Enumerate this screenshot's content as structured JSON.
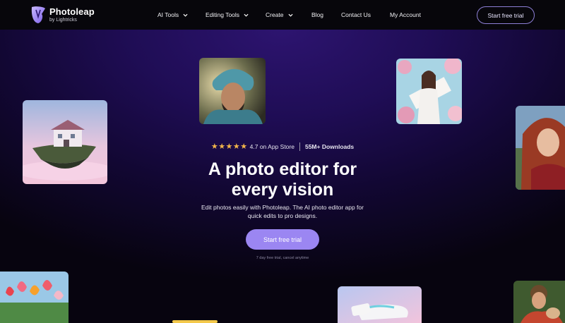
{
  "brand": {
    "name": "Photoleap",
    "sub": "by Lightricks"
  },
  "nav": {
    "items": [
      {
        "label": "AI Tools",
        "dropdown": true
      },
      {
        "label": "Editing Tools",
        "dropdown": true
      },
      {
        "label": "Create",
        "dropdown": true
      },
      {
        "label": "Blog",
        "dropdown": false
      },
      {
        "label": "Contact Us",
        "dropdown": false
      },
      {
        "label": "My Account",
        "dropdown": false
      }
    ],
    "cta": "Start free trial"
  },
  "hero": {
    "stars": "★★★★★",
    "rating": "4.7 on App Store",
    "downloads": "55M+ Downloads",
    "headline_line1": "A photo editor for",
    "headline_line2": "every vision",
    "subtext": "Edit photos easily with Photoleap. The AI photo editor app for quick edits to pro designs.",
    "cta": "Start free trial",
    "note": "7 day free trial, cancel anytime"
  },
  "colors": {
    "accent": "#9b86f2",
    "star": "#f2b64a",
    "nav_bg": "#07060b"
  }
}
